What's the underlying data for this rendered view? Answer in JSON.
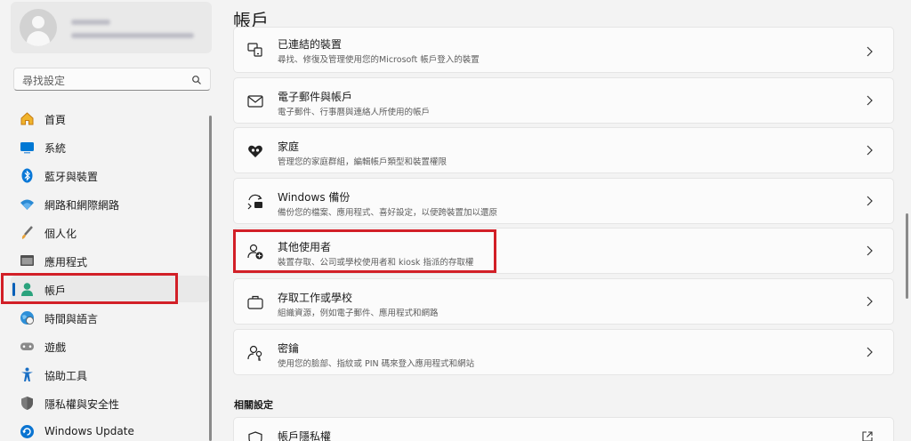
{
  "sidebar": {
    "search_placeholder": "尋找設定",
    "items": [
      {
        "label": "首頁",
        "icon": "home-icon"
      },
      {
        "label": "系統",
        "icon": "system-icon"
      },
      {
        "label": "藍牙與裝置",
        "icon": "bluetooth-icon"
      },
      {
        "label": "網路和網際網路",
        "icon": "wifi-icon"
      },
      {
        "label": "個人化",
        "icon": "brush-icon"
      },
      {
        "label": "應用程式",
        "icon": "apps-icon"
      },
      {
        "label": "帳戶",
        "icon": "accounts-icon",
        "selected": true
      },
      {
        "label": "時間與語言",
        "icon": "globe-clock-icon"
      },
      {
        "label": "遊戲",
        "icon": "gamepad-icon"
      },
      {
        "label": "協助工具",
        "icon": "accessibility-icon"
      },
      {
        "label": "隱私權與安全性",
        "icon": "shield-icon"
      },
      {
        "label": "Windows Update",
        "icon": "windows-update-icon"
      }
    ]
  },
  "main": {
    "title": "帳戶",
    "cards": [
      {
        "title": "已連結的裝置",
        "desc": "尋找、修復及管理使用您的Microsoft 帳戶登入的裝置",
        "icon": "linked-devices-icon"
      },
      {
        "title": "電子郵件與帳戶",
        "desc": "電子郵件、行事曆與連絡人所使用的帳戶",
        "icon": "mail-icon"
      },
      {
        "title": "家庭",
        "desc": "管理您的家庭群組，編輯帳戶類型和裝置權限",
        "icon": "family-heart-icon"
      },
      {
        "title": "Windows 備份",
        "desc": "備份您的檔案、應用程式、喜好設定，以便跨裝置加以還原",
        "icon": "backup-icon"
      },
      {
        "title": "其他使用者",
        "desc": "裝置存取、公司或學校使用者和 kiosk 指派的存取權",
        "icon": "add-user-icon"
      },
      {
        "title": "存取工作或學校",
        "desc": "組織資源，例如電子郵件、應用程式和網路",
        "icon": "briefcase-icon"
      },
      {
        "title": "密鑰",
        "desc": "使用您的臉部、指紋或 PIN 碼來登入應用程式和網站",
        "icon": "passkey-icon"
      }
    ],
    "related_title": "相關設定",
    "related": [
      {
        "title": "帳戶隱私權",
        "icon": "privacy-shield-icon"
      }
    ]
  },
  "colors": {
    "accent": "#005fb8",
    "highlight": "#d21f27"
  }
}
